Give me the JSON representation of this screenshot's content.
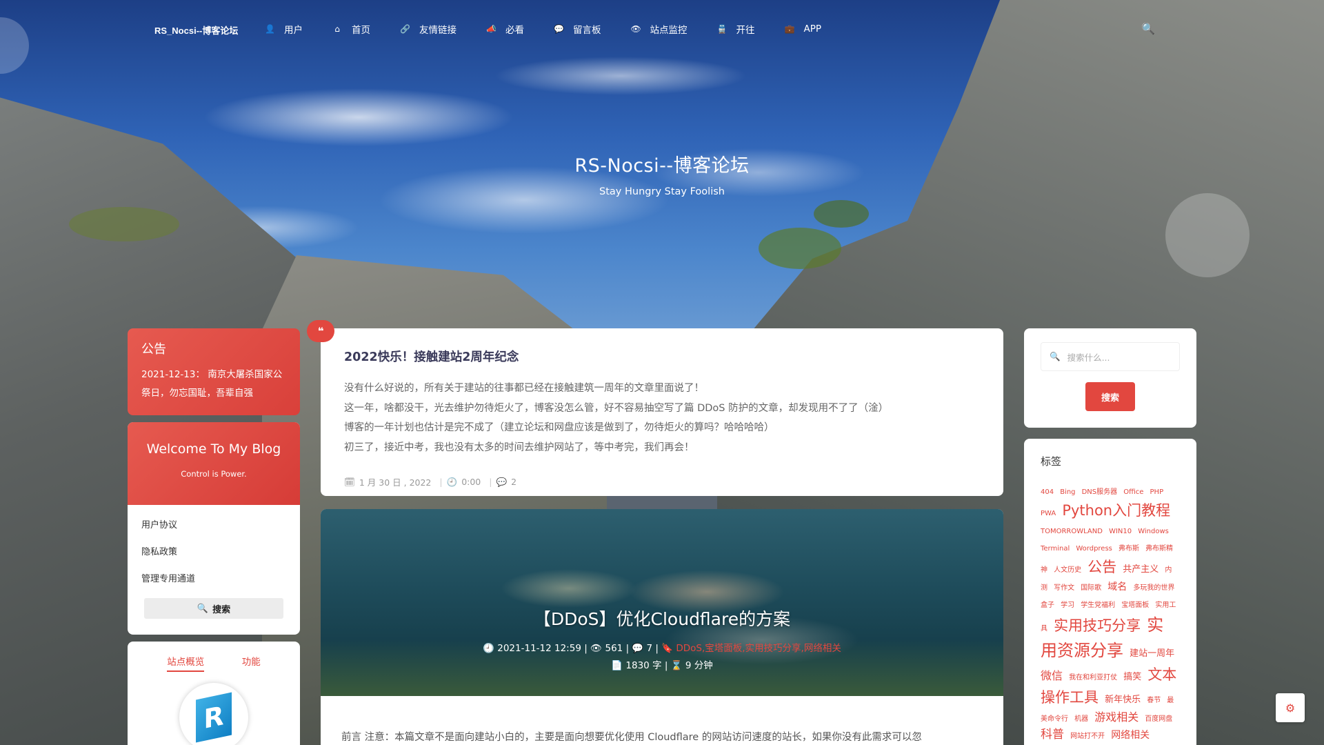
{
  "nav": {
    "brand": "RS_Nocsi--博客论坛",
    "items": [
      {
        "icon": "user-icon",
        "glyph": "👤",
        "label": "用户"
      },
      {
        "icon": "home-icon",
        "glyph": "⌂",
        "label": "首页"
      },
      {
        "icon": "link-icon",
        "glyph": "🔗",
        "label": "友情链接"
      },
      {
        "icon": "megaphone-icon",
        "glyph": "📣",
        "label": "必看"
      },
      {
        "icon": "comment-icon",
        "glyph": "💬",
        "label": "留言板"
      },
      {
        "icon": "eye-icon",
        "glyph": "👁",
        "label": "站点监控"
      },
      {
        "icon": "train-icon",
        "glyph": "🚆",
        "label": "开往"
      },
      {
        "icon": "briefcase-icon",
        "glyph": "💼",
        "label": "APP"
      }
    ],
    "search_icon": "search-icon"
  },
  "hero": {
    "title": "RS-Nocsi--博客论坛",
    "subtitle": "Stay Hungry Stay Foolish"
  },
  "notice": {
    "title": "公告",
    "text": "2021-12-13：  南京大屠杀国家公祭日，勿忘国耻，吾辈自强"
  },
  "welcome": {
    "title": "Welcome To My Blog",
    "subtitle": "Control is Power.",
    "links": [
      "用户协议",
      "隐私政策",
      "管理专用通道"
    ],
    "search_label": "搜索"
  },
  "site_card": {
    "tabs": [
      "站点概览",
      "功能"
    ],
    "logo_letter": "R"
  },
  "posts": [
    {
      "title": "2022快乐！接触建站2周年纪念",
      "quote_glyph": "❝",
      "lines": [
        "没有什么好说的，所有关于建站的往事都已经在接触建筑一周年的文章里面说了！",
        "这一年，啥都没干，光去维护勿待炬火了，博客没怎么管，好不容易抽空写了篇 DDoS 防护的文章，却发现用不了了（淦）",
        "博客的一年计划也估计是完不成了（建立论坛和网盘应该是做到了，勿待炬火的算吗？哈哈哈哈）",
        "初三了，接近中考，我也没有太多的时间去维护网站了，等中考完，我们再会！"
      ],
      "date": "1 月 30 日 , 2022",
      "time": "0:00",
      "comments": "2"
    },
    {
      "title": "【DDoS】优化Cloudflare的方案",
      "datetime": "2021-11-12 12:59",
      "views": "561",
      "comments": "7",
      "tags": "DDoS,宝塔面板,实用技巧分享,网络相关",
      "words": "1830 字",
      "read_time": "9 分钟",
      "excerpt": "前言 注意：本篇文章不是面向建站小白的，主要是面向想要优化使用 Cloudflare 的网站访问速度的站长，如果你没有此需求可以忽"
    }
  ],
  "sidebar": {
    "search_placeholder": "搜索什么...",
    "search_button": "搜索",
    "tags_title": "标签",
    "tags": [
      {
        "t": "404",
        "s": 10
      },
      {
        "t": "Bing",
        "s": 10
      },
      {
        "t": "DNS服务器",
        "s": 10
      },
      {
        "t": "Office",
        "s": 10
      },
      {
        "t": "PHP",
        "s": 10
      },
      {
        "t": "PWA",
        "s": 10
      },
      {
        "t": "Python入门教程",
        "s": 21
      },
      {
        "t": "TOMORROWLAND",
        "s": 10
      },
      {
        "t": "WIN10",
        "s": 10
      },
      {
        "t": "Windows",
        "s": 10
      },
      {
        "t": "Terminal",
        "s": 10
      },
      {
        "t": "Wordpress",
        "s": 10
      },
      {
        "t": "弗布斯",
        "s": 10
      },
      {
        "t": "弗布斯精神",
        "s": 10
      },
      {
        "t": "人文历史",
        "s": 10
      },
      {
        "t": "公告",
        "s": 21
      },
      {
        "t": "共产主义",
        "s": 13
      },
      {
        "t": "内测",
        "s": 10
      },
      {
        "t": "写作文",
        "s": 10
      },
      {
        "t": "国际歌",
        "s": 10
      },
      {
        "t": "域名",
        "s": 14
      },
      {
        "t": "多玩我的世界盒子",
        "s": 10
      },
      {
        "t": "学习",
        "s": 10
      },
      {
        "t": "学生党福利",
        "s": 10
      },
      {
        "t": "宝塔面板",
        "s": 10
      },
      {
        "t": "实用工具",
        "s": 10
      },
      {
        "t": "实用技巧分享",
        "s": 21
      },
      {
        "t": "实用资源分享",
        "s": 24
      },
      {
        "t": "建站一周年",
        "s": 13
      },
      {
        "t": "微信",
        "s": 16
      },
      {
        "t": "我在和利亚打仗",
        "s": 10
      },
      {
        "t": "搞笑",
        "s": 13
      },
      {
        "t": "文本操作工具",
        "s": 21
      },
      {
        "t": "新年快乐",
        "s": 13
      },
      {
        "t": "春节",
        "s": 10
      },
      {
        "t": "最美命令行",
        "s": 10
      },
      {
        "t": "机器",
        "s": 10
      },
      {
        "t": "游戏相关",
        "s": 16
      },
      {
        "t": "百度网盘",
        "s": 10
      },
      {
        "t": "科普",
        "s": 17
      },
      {
        "t": "网站打不开",
        "s": 10
      },
      {
        "t": "网络相关",
        "s": 14
      }
    ]
  },
  "gear_icon": "gear-icon",
  "colors": {
    "accent": "#e2473f",
    "title": "#3a3a5a"
  }
}
